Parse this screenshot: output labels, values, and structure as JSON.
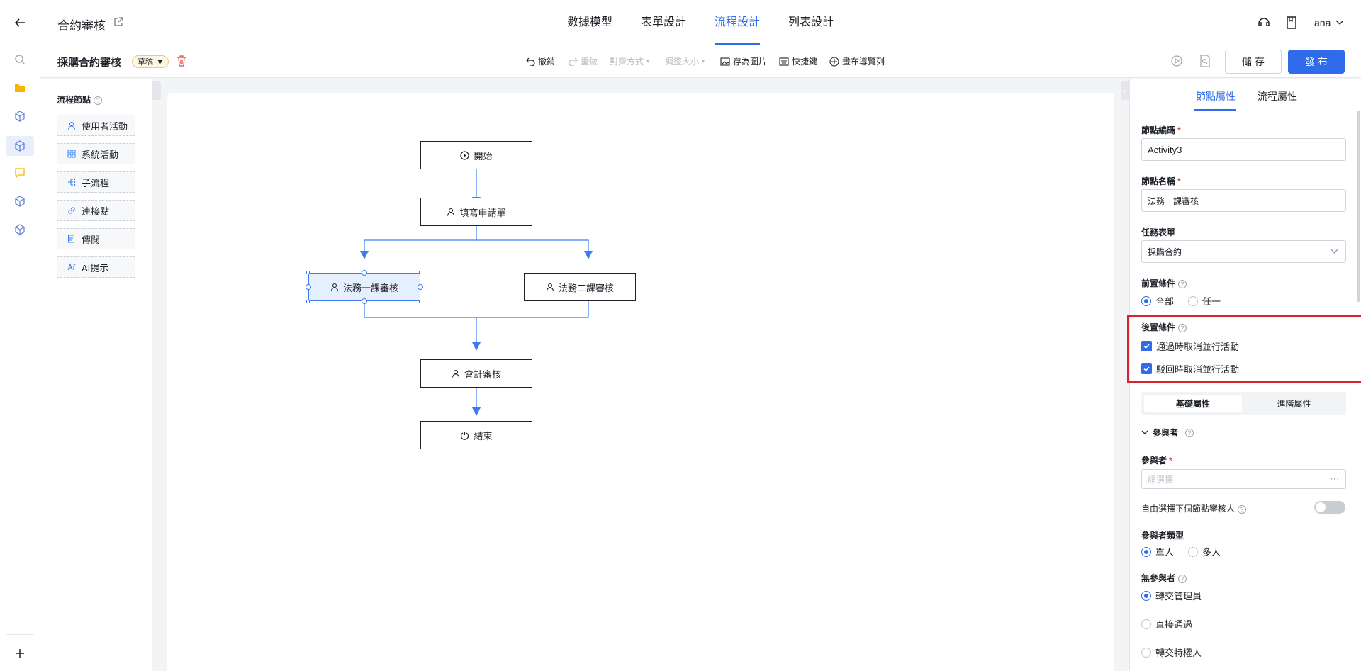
{
  "header": {
    "app_title": "合約審核",
    "tabs": [
      {
        "label": "數據模型"
      },
      {
        "label": "表單設計"
      },
      {
        "label": "流程設計",
        "active": true
      },
      {
        "label": "列表設計"
      }
    ],
    "user": "ana"
  },
  "subbar": {
    "process_name": "採購合約審核",
    "status_badge": "草稿",
    "tools": {
      "undo": "撤銷",
      "redo": "重做",
      "align": "對齊方式",
      "resize": "調整大小",
      "save_image": "存為圖片",
      "shortcuts": "快捷鍵",
      "canvas_nav": "畫布導覽列"
    },
    "save_label": "儲 存",
    "publish_label": "發 布"
  },
  "node_panel": {
    "title": "流程節點",
    "items": [
      {
        "label": "使用者活動",
        "icon": "user-icon"
      },
      {
        "label": "系統活動",
        "icon": "grid-icon"
      },
      {
        "label": "子流程",
        "icon": "subprocess-icon"
      },
      {
        "label": "連接點",
        "icon": "link-icon"
      },
      {
        "label": "傳閱",
        "icon": "document-icon"
      },
      {
        "label": "AI提示",
        "icon": "ai-icon"
      }
    ]
  },
  "flow": {
    "start": "開始",
    "fill": "填寫申請單",
    "legal1": "法務一課審核",
    "legal2": "法務二課審核",
    "accounting": "會計審核",
    "end": "結束"
  },
  "right_panel": {
    "tabs": [
      {
        "label": "節點屬性",
        "active": true
      },
      {
        "label": "流程屬性"
      }
    ],
    "node_code_label": "節點編碼",
    "node_code_value": "Activity3",
    "node_name_label": "節點名稱",
    "node_name_value": "法務一課審核",
    "task_form_label": "任務表單",
    "task_form_value": "採購合約",
    "precondition_label": "前置條件",
    "precondition_options": [
      "全部",
      "任一"
    ],
    "postcondition_label": "後置條件",
    "post_options": [
      "通過時取消並行活動",
      "駁回時取消並行活動"
    ],
    "subtabs": [
      "基礎屬性",
      "進階屬性"
    ],
    "participants_section": "參與者",
    "participants_label": "參與者",
    "participants_placeholder": "請選擇",
    "free_select_label": "自由選擇下個節點審核人",
    "participant_type_label": "參與者類型",
    "participant_type_options": [
      "單人",
      "多人"
    ],
    "no_participant_label": "無參與者",
    "no_participant_options": [
      "轉交管理員",
      "直接通過",
      "轉交特權人"
    ]
  },
  "colors": {
    "accent": "#2f6bea",
    "highlight_box": "#d9232d"
  }
}
